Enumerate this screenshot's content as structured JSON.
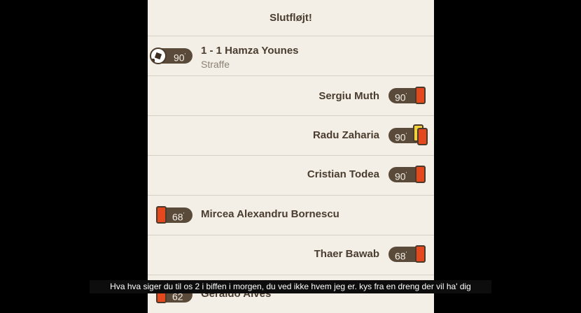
{
  "header": {
    "title": "Slutfløjt!"
  },
  "events": [
    {
      "minute": "90",
      "side": "left",
      "icon": "ball-icon",
      "name": "1 - 1 Hamza Younes",
      "detail": "Straffe"
    },
    {
      "minute": "90",
      "side": "right",
      "icon": "red-card-icon",
      "name": "Sergiu Muth"
    },
    {
      "minute": "90",
      "side": "right",
      "icon": "second-yellow-red-card-icon",
      "name": "Radu Zaharia"
    },
    {
      "minute": "90",
      "side": "right",
      "icon": "red-card-icon",
      "name": "Cristian Todea"
    },
    {
      "minute": "68",
      "side": "left",
      "icon": "red-card-icon",
      "name": "Mircea Alexandru Bornescu"
    },
    {
      "minute": "68",
      "side": "right",
      "icon": "red-card-icon",
      "name": "Thaer Bawab"
    },
    {
      "minute": "62",
      "side": "left",
      "icon": "red-card-icon",
      "name": "Geraldo Alves"
    }
  ],
  "caption": {
    "text": "Hva hva siger du til os 2 i biffen i morgen, du ved ikke hvem jeg er. kys fra en dreng der vil ha' dig"
  },
  "colors": {
    "panel": "#f3efe6",
    "pill": "#5a4a3a",
    "red_card": "#e4481e",
    "yellow_card": "#f2d13d",
    "text": "#4a3c2e"
  }
}
